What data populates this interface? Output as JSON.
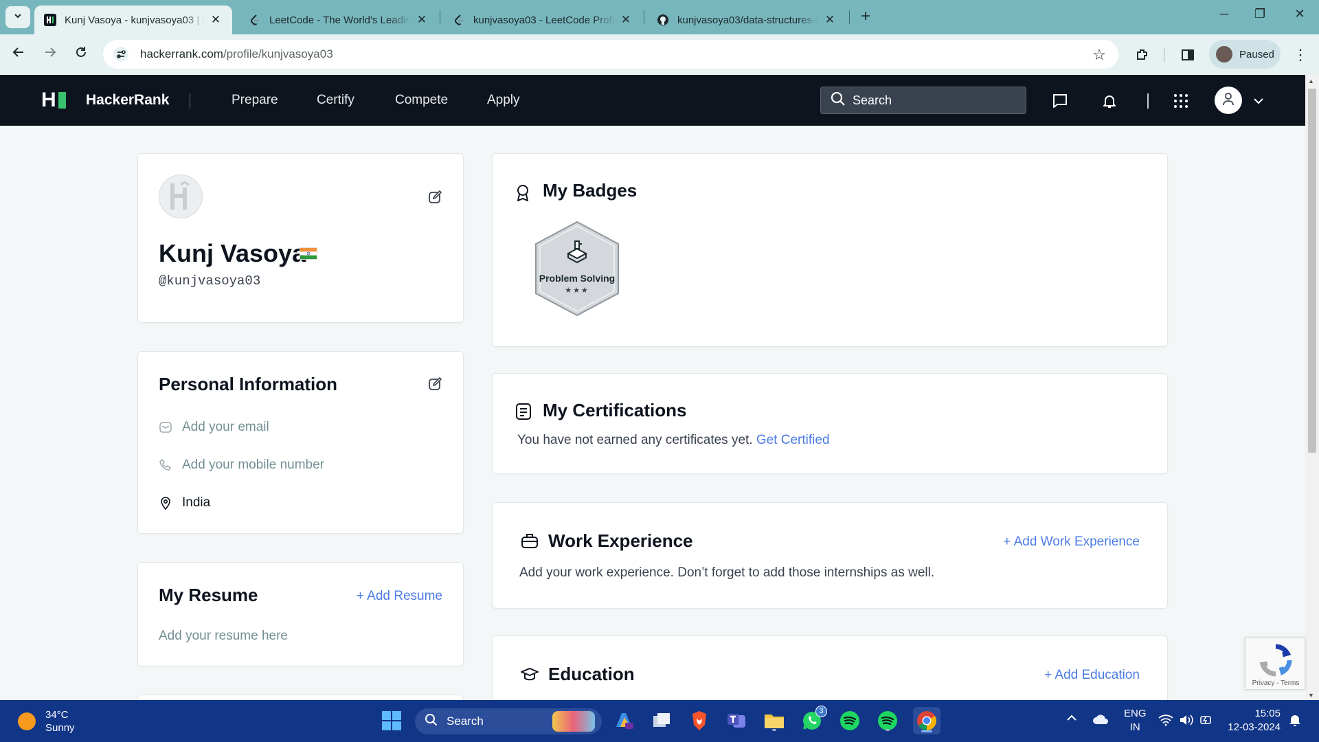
{
  "browser": {
    "tabs": [
      {
        "title": "Kunj Vasoya - kunjvasoya03 | Ha",
        "active": true
      },
      {
        "title": "LeetCode - The World's Leading",
        "active": false
      },
      {
        "title": "kunjvasoya03 - LeetCode Profile",
        "active": false
      },
      {
        "title": "kunjvasoya03/data-structures-a",
        "active": false
      }
    ],
    "url_host": "hackerrank.com",
    "url_path": "/profile/kunjvasoya03",
    "profile_status": "Paused"
  },
  "header": {
    "brand": "HackerRank",
    "nav": [
      "Prepare",
      "Certify",
      "Compete",
      "Apply"
    ],
    "search_placeholder": "Search"
  },
  "profile": {
    "name": "Kunj Vasoya",
    "username": "@kunjvasoya03",
    "country_flag": "India"
  },
  "personal_info": {
    "title": "Personal Information",
    "email": "Add your email",
    "mobile": "Add your mobile number",
    "location": "India"
  },
  "resume": {
    "title": "My Resume",
    "add_label": "+ Add Resume",
    "placeholder": "Add your resume here"
  },
  "badges": {
    "title": "My Badges",
    "items": [
      {
        "label": "Problem Solving",
        "stars": "★★★",
        "star_count": 3
      }
    ]
  },
  "certifications": {
    "title": "My Certifications",
    "text": "You have not earned any certificates yet.",
    "link": "Get Certified"
  },
  "work": {
    "title": "Work Experience",
    "add_label": "+ Add Work Experience",
    "text": "Add your work experience. Don’t forget to add those internships as well."
  },
  "education": {
    "title": "Education",
    "add_label": "+ Add Education"
  },
  "recaptcha": {
    "text": "Privacy - Terms"
  },
  "taskbar": {
    "weather_temp": "34°C",
    "weather_desc": "Sunny",
    "search_label": "Search",
    "whatsapp_badge": "3",
    "lang_top": "ENG",
    "lang_bottom": "IN",
    "time": "15:05",
    "date": "12-03-2024"
  },
  "colors": {
    "hr_header": "#0e141e",
    "hr_green": "#39c26d",
    "link_blue": "#1f8acb",
    "add_blue": "#4c7ce4",
    "taskbar": "#113587"
  }
}
